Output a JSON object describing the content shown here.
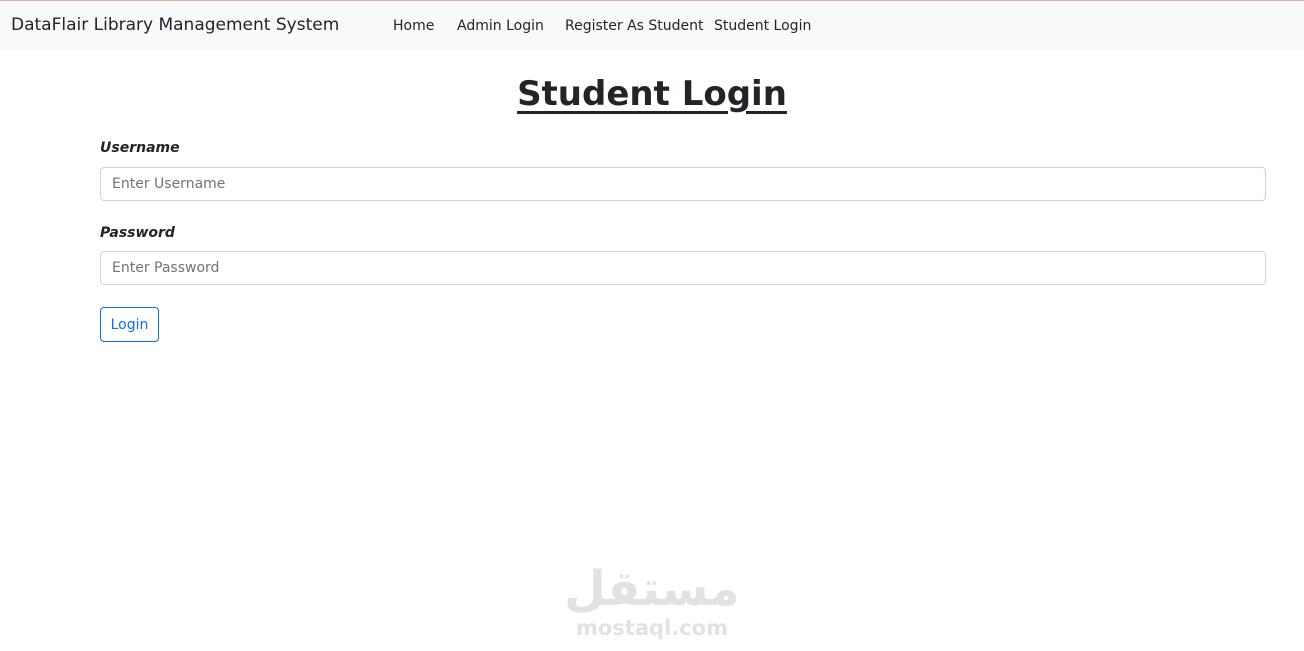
{
  "navbar": {
    "brand": "DataFlair Library Management System",
    "links": [
      {
        "label": "Home"
      },
      {
        "label": "Admin Login"
      },
      {
        "label": "Register As Student"
      },
      {
        "label": "Student Login"
      }
    ]
  },
  "page": {
    "title": "Student Login"
  },
  "form": {
    "username": {
      "label": "Username",
      "value": "",
      "placeholder": "Enter Username"
    },
    "password": {
      "label": "Password",
      "value": "",
      "placeholder": "Enter Password"
    },
    "submit_label": "Login"
  },
  "watermark": {
    "logo_text": "مستقل",
    "domain": "mostaql.com"
  },
  "colors": {
    "navbar_bg": "#f8f9fa",
    "button_primary": "#0d6efd",
    "input_border": "#ced4da",
    "watermark": "#e2e2e2"
  }
}
